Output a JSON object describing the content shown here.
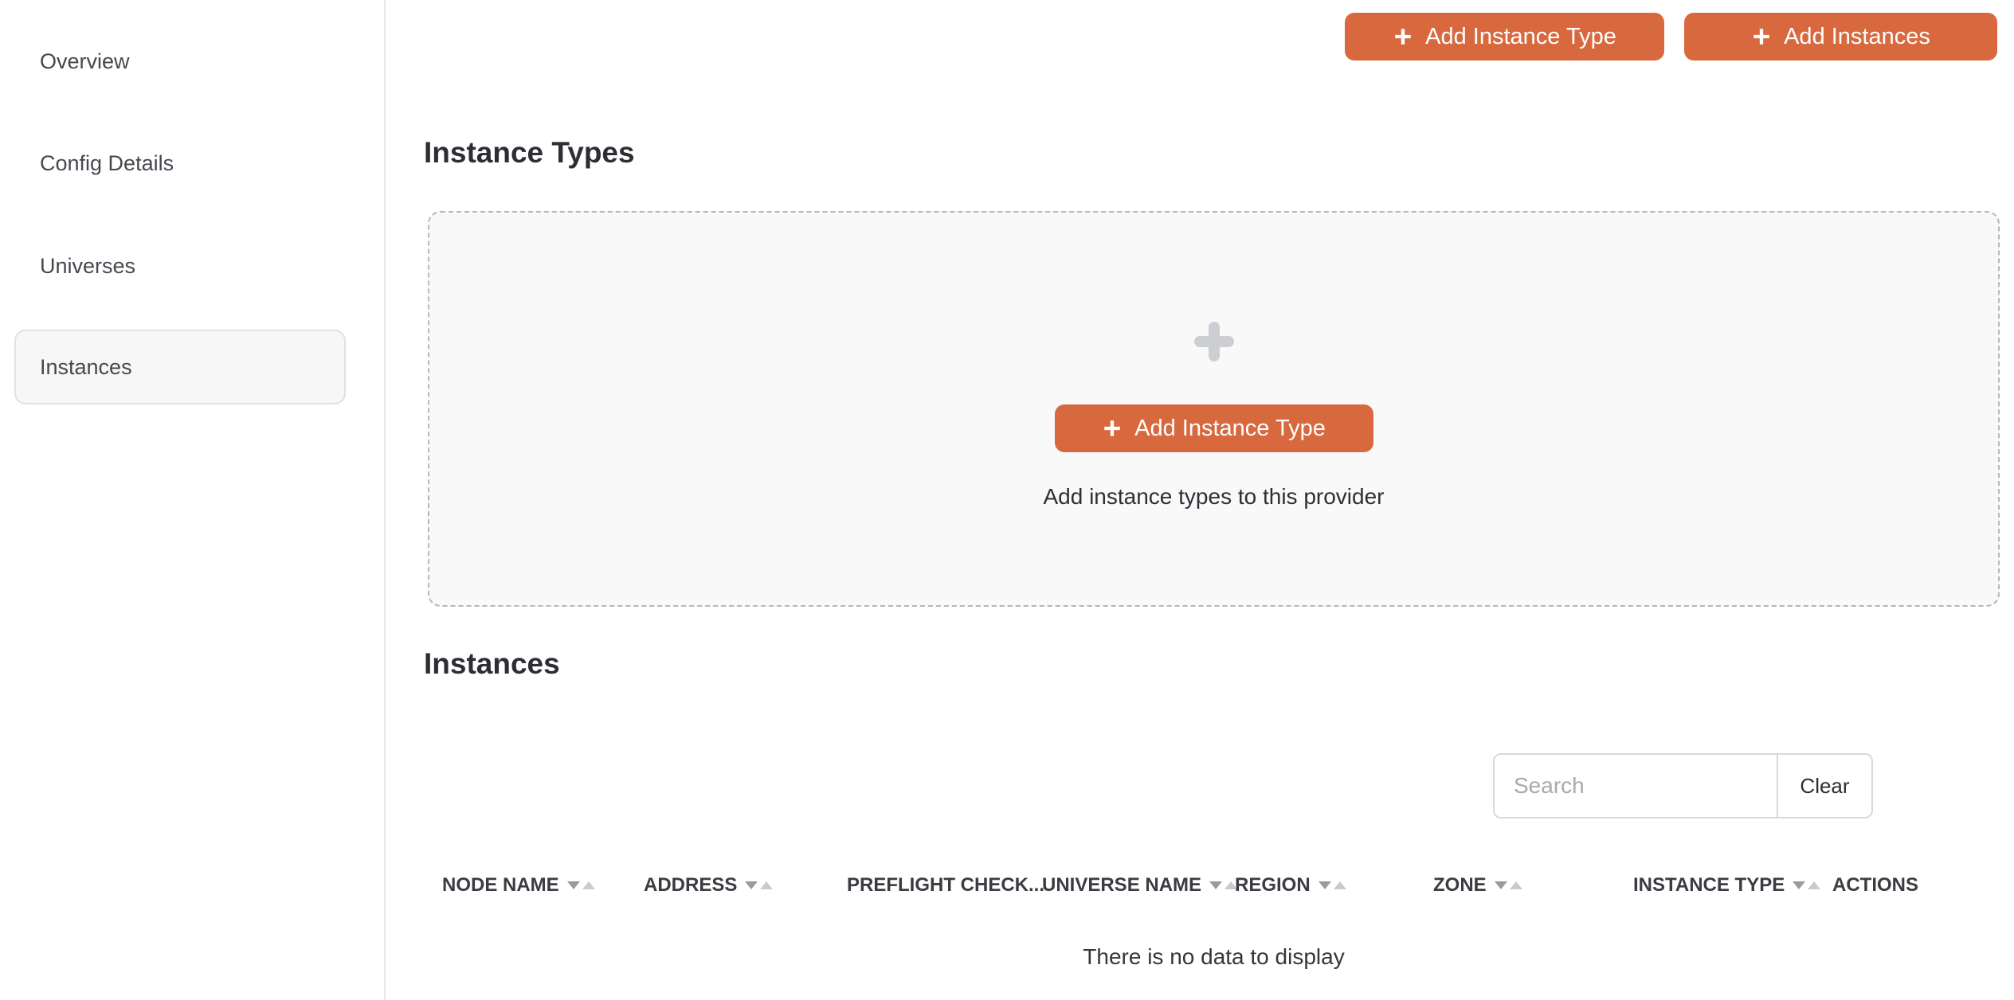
{
  "sidebar": {
    "items": [
      {
        "label": "Overview",
        "active": false
      },
      {
        "label": "Config Details",
        "active": false
      },
      {
        "label": "Universes",
        "active": false
      },
      {
        "label": "Instances",
        "active": true
      }
    ]
  },
  "toolbar": {
    "add_instance_type_label": "Add Instance Type",
    "add_instances_label": "Add Instances"
  },
  "instance_types_section": {
    "title": "Instance Types",
    "empty_state": {
      "add_button_label": "Add Instance Type",
      "caption": "Add instance types to this provider"
    }
  },
  "instances_section": {
    "title": "Instances",
    "search": {
      "placeholder": "Search",
      "value": "",
      "clear_label": "Clear"
    },
    "table": {
      "columns": [
        {
          "label": "NODE NAME",
          "sortable": true
        },
        {
          "label": "ADDRESS",
          "sortable": true
        },
        {
          "label": "PREFLIGHT CHECK...",
          "sortable": false
        },
        {
          "label": "UNIVERSE NAME",
          "sortable": true
        },
        {
          "label": "REGION",
          "sortable": true
        },
        {
          "label": "ZONE",
          "sortable": true
        },
        {
          "label": "INSTANCE TYPE",
          "sortable": true
        },
        {
          "label": "ACTIONS",
          "sortable": false
        }
      ],
      "rows": [],
      "empty_message": "There is no data to display"
    }
  },
  "colors": {
    "accent": "#D8693F",
    "sidebar_active_bg": "#F7F7F8",
    "panel_bg": "#F9F9FA",
    "dashed_border": "#B6B6BB"
  }
}
